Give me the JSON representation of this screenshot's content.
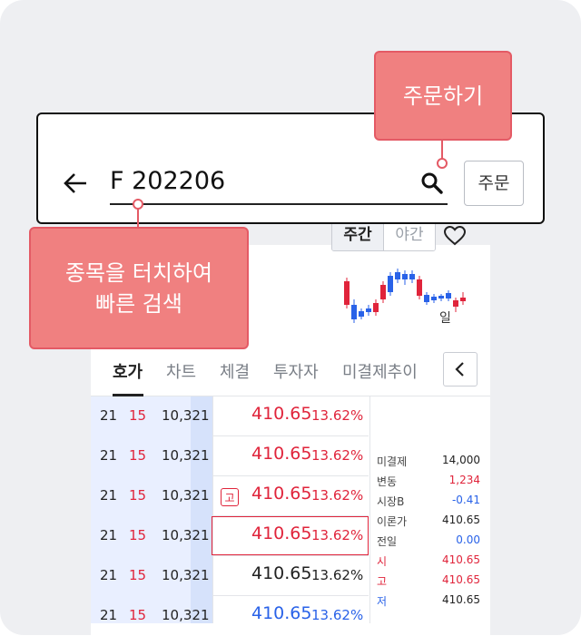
{
  "search": {
    "code": "F 202206",
    "order_button": "주문"
  },
  "session": {
    "day": "주간",
    "night": "야간"
  },
  "mini_chart": {
    "period_label": "일"
  },
  "tabs": [
    "호가",
    "차트",
    "체결",
    "투자자",
    "미결제추이"
  ],
  "orderbook": {
    "rows": [
      {
        "c1": "21",
        "c2": "15",
        "c3": "10,321",
        "price": "410.65",
        "pct": "13.62%",
        "color": "red"
      },
      {
        "c1": "21",
        "c2": "15",
        "c3": "10,321",
        "price": "410.65",
        "pct": "13.62%",
        "color": "red"
      },
      {
        "c1": "21",
        "c2": "15",
        "c3": "10,321",
        "price": "410.65",
        "pct": "13.62%",
        "color": "red",
        "badge": "고"
      },
      {
        "c1": "21",
        "c2": "15",
        "c3": "10,321",
        "price": "410.65",
        "pct": "13.62%",
        "color": "red",
        "current": true
      },
      {
        "c1": "21",
        "c2": "15",
        "c3": "10,321",
        "price": "410.65",
        "pct": "13.62%",
        "color": "black"
      },
      {
        "c1": "21",
        "c2": "15",
        "c3": "10,321",
        "price": "410.65",
        "pct": "13.62%",
        "color": "blue"
      }
    ]
  },
  "info": [
    {
      "label": "미결제",
      "value": "14,000",
      "label_color": "#444444",
      "value_color": "#222222"
    },
    {
      "label": "변동",
      "value": "1,234",
      "label_color": "#444444",
      "value_color": "#e0243b"
    },
    {
      "label": "시장B",
      "value": "-0.41",
      "label_color": "#444444",
      "value_color": "#2962e8"
    },
    {
      "label": "이론가",
      "value": "410.65",
      "label_color": "#444444",
      "value_color": "#222222"
    },
    {
      "label": "전일",
      "value": "0.00",
      "label_color": "#444444",
      "value_color": "#2962e8"
    },
    {
      "label": "시",
      "value": "410.65",
      "label_color": "#e0243b",
      "value_color": "#e0243b"
    },
    {
      "label": "고",
      "value": "410.65",
      "label_color": "#e0243b",
      "value_color": "#e0243b"
    },
    {
      "label": "저",
      "value": "410.65",
      "label_color": "#2962e8",
      "value_color": "#222222"
    }
  ],
  "callouts": {
    "order": "주문하기",
    "search_line1": "종목을 터치하여",
    "search_line2": "빠른 검색"
  },
  "colors": {
    "up": "#e0243b",
    "down": "#2962e8",
    "callout": "#f08080"
  }
}
